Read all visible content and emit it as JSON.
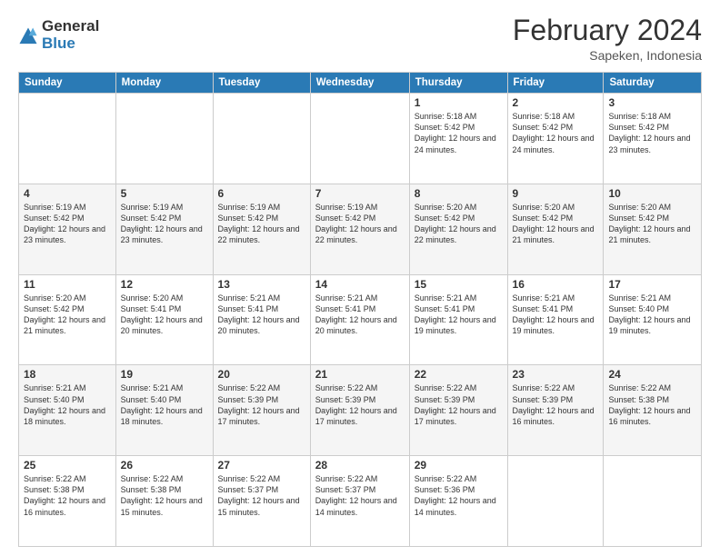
{
  "logo": {
    "general": "General",
    "blue": "Blue"
  },
  "header": {
    "month": "February 2024",
    "location": "Sapeken, Indonesia"
  },
  "days_of_week": [
    "Sunday",
    "Monday",
    "Tuesday",
    "Wednesday",
    "Thursday",
    "Friday",
    "Saturday"
  ],
  "weeks": [
    [
      {
        "day": "",
        "info": ""
      },
      {
        "day": "",
        "info": ""
      },
      {
        "day": "",
        "info": ""
      },
      {
        "day": "",
        "info": ""
      },
      {
        "day": "1",
        "info": "Sunrise: 5:18 AM\nSunset: 5:42 PM\nDaylight: 12 hours and 24 minutes."
      },
      {
        "day": "2",
        "info": "Sunrise: 5:18 AM\nSunset: 5:42 PM\nDaylight: 12 hours and 24 minutes."
      },
      {
        "day": "3",
        "info": "Sunrise: 5:18 AM\nSunset: 5:42 PM\nDaylight: 12 hours and 23 minutes."
      }
    ],
    [
      {
        "day": "4",
        "info": "Sunrise: 5:19 AM\nSunset: 5:42 PM\nDaylight: 12 hours and 23 minutes."
      },
      {
        "day": "5",
        "info": "Sunrise: 5:19 AM\nSunset: 5:42 PM\nDaylight: 12 hours and 23 minutes."
      },
      {
        "day": "6",
        "info": "Sunrise: 5:19 AM\nSunset: 5:42 PM\nDaylight: 12 hours and 22 minutes."
      },
      {
        "day": "7",
        "info": "Sunrise: 5:19 AM\nSunset: 5:42 PM\nDaylight: 12 hours and 22 minutes."
      },
      {
        "day": "8",
        "info": "Sunrise: 5:20 AM\nSunset: 5:42 PM\nDaylight: 12 hours and 22 minutes."
      },
      {
        "day": "9",
        "info": "Sunrise: 5:20 AM\nSunset: 5:42 PM\nDaylight: 12 hours and 21 minutes."
      },
      {
        "day": "10",
        "info": "Sunrise: 5:20 AM\nSunset: 5:42 PM\nDaylight: 12 hours and 21 minutes."
      }
    ],
    [
      {
        "day": "11",
        "info": "Sunrise: 5:20 AM\nSunset: 5:42 PM\nDaylight: 12 hours and 21 minutes."
      },
      {
        "day": "12",
        "info": "Sunrise: 5:20 AM\nSunset: 5:41 PM\nDaylight: 12 hours and 20 minutes."
      },
      {
        "day": "13",
        "info": "Sunrise: 5:21 AM\nSunset: 5:41 PM\nDaylight: 12 hours and 20 minutes."
      },
      {
        "day": "14",
        "info": "Sunrise: 5:21 AM\nSunset: 5:41 PM\nDaylight: 12 hours and 20 minutes."
      },
      {
        "day": "15",
        "info": "Sunrise: 5:21 AM\nSunset: 5:41 PM\nDaylight: 12 hours and 19 minutes."
      },
      {
        "day": "16",
        "info": "Sunrise: 5:21 AM\nSunset: 5:41 PM\nDaylight: 12 hours and 19 minutes."
      },
      {
        "day": "17",
        "info": "Sunrise: 5:21 AM\nSunset: 5:40 PM\nDaylight: 12 hours and 19 minutes."
      }
    ],
    [
      {
        "day": "18",
        "info": "Sunrise: 5:21 AM\nSunset: 5:40 PM\nDaylight: 12 hours and 18 minutes."
      },
      {
        "day": "19",
        "info": "Sunrise: 5:21 AM\nSunset: 5:40 PM\nDaylight: 12 hours and 18 minutes."
      },
      {
        "day": "20",
        "info": "Sunrise: 5:22 AM\nSunset: 5:39 PM\nDaylight: 12 hours and 17 minutes."
      },
      {
        "day": "21",
        "info": "Sunrise: 5:22 AM\nSunset: 5:39 PM\nDaylight: 12 hours and 17 minutes."
      },
      {
        "day": "22",
        "info": "Sunrise: 5:22 AM\nSunset: 5:39 PM\nDaylight: 12 hours and 17 minutes."
      },
      {
        "day": "23",
        "info": "Sunrise: 5:22 AM\nSunset: 5:39 PM\nDaylight: 12 hours and 16 minutes."
      },
      {
        "day": "24",
        "info": "Sunrise: 5:22 AM\nSunset: 5:38 PM\nDaylight: 12 hours and 16 minutes."
      }
    ],
    [
      {
        "day": "25",
        "info": "Sunrise: 5:22 AM\nSunset: 5:38 PM\nDaylight: 12 hours and 16 minutes."
      },
      {
        "day": "26",
        "info": "Sunrise: 5:22 AM\nSunset: 5:38 PM\nDaylight: 12 hours and 15 minutes."
      },
      {
        "day": "27",
        "info": "Sunrise: 5:22 AM\nSunset: 5:37 PM\nDaylight: 12 hours and 15 minutes."
      },
      {
        "day": "28",
        "info": "Sunrise: 5:22 AM\nSunset: 5:37 PM\nDaylight: 12 hours and 14 minutes."
      },
      {
        "day": "29",
        "info": "Sunrise: 5:22 AM\nSunset: 5:36 PM\nDaylight: 12 hours and 14 minutes."
      },
      {
        "day": "",
        "info": ""
      },
      {
        "day": "",
        "info": ""
      }
    ]
  ]
}
